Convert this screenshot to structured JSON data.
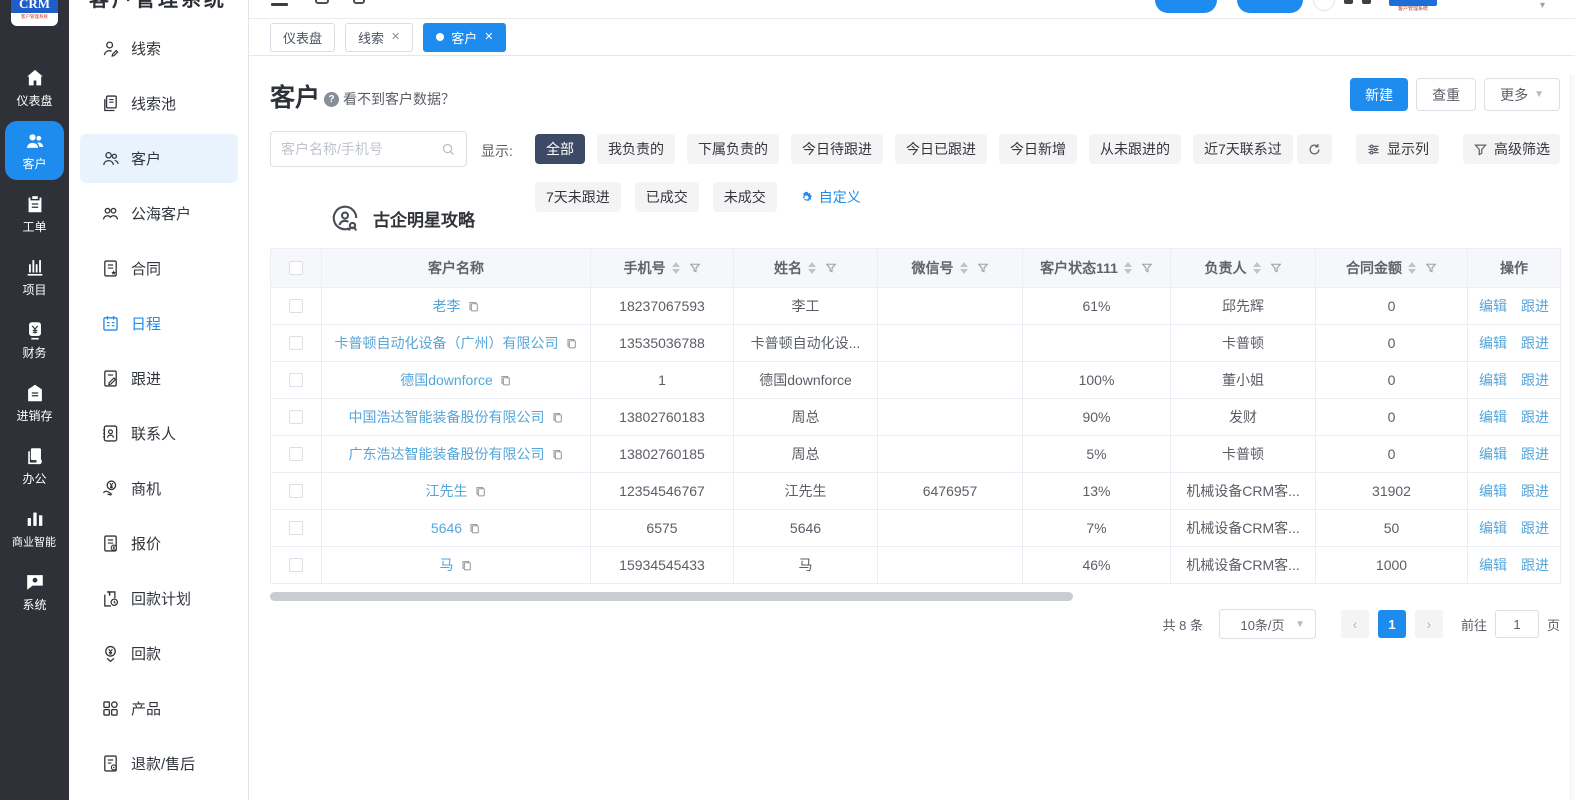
{
  "colors": {
    "accent": "#1e8cee",
    "link": "#55a6da",
    "chip_selected_bg": "#3d4a66",
    "sidebar_bg": "#2e3138"
  },
  "logo": {
    "title": "CRM",
    "subtitle": "客户管理系统"
  },
  "primary_nav": [
    {
      "label": "仪表盘",
      "icon": "dashboard-home-icon",
      "active": false
    },
    {
      "label": "客户",
      "icon": "customers-icon",
      "active": true
    },
    {
      "label": "工单",
      "icon": "work-order-icon",
      "active": false
    },
    {
      "label": "项目",
      "icon": "project-icon",
      "active": false
    },
    {
      "label": "财务",
      "icon": "finance-icon",
      "active": false
    },
    {
      "label": "进销存",
      "icon": "inventory-icon",
      "active": false
    },
    {
      "label": "办公",
      "icon": "office-icon",
      "active": false
    },
    {
      "label": "商业智能",
      "icon": "bi-icon",
      "active": false
    },
    {
      "label": "系统",
      "icon": "system-icon",
      "active": false
    }
  ],
  "secondary_nav": [
    {
      "label": "线索",
      "icon": "leads-icon",
      "active": false,
      "highlight": false
    },
    {
      "label": "线索池",
      "icon": "lead-pool-icon",
      "active": false,
      "highlight": false
    },
    {
      "label": "客户",
      "icon": "customer-icon",
      "active": true,
      "highlight": false
    },
    {
      "label": "公海客户",
      "icon": "public-customers-icon",
      "active": false,
      "highlight": false
    },
    {
      "label": "合同",
      "icon": "contract-icon",
      "active": false,
      "highlight": false
    },
    {
      "label": "日程",
      "icon": "schedule-icon",
      "active": false,
      "highlight": true
    },
    {
      "label": "跟进",
      "icon": "follow-up-icon",
      "active": false,
      "highlight": false
    },
    {
      "label": "联系人",
      "icon": "contacts-icon",
      "active": false,
      "highlight": false
    },
    {
      "label": "商机",
      "icon": "opportunity-icon",
      "active": false,
      "highlight": false
    },
    {
      "label": "报价",
      "icon": "quotation-icon",
      "active": false,
      "highlight": false
    },
    {
      "label": "回款计划",
      "icon": "payment-plan-icon",
      "active": false,
      "highlight": false
    },
    {
      "label": "回款",
      "icon": "payment-icon",
      "active": false,
      "highlight": false
    },
    {
      "label": "产品",
      "icon": "product-icon",
      "active": false,
      "highlight": false
    },
    {
      "label": "退款/售后",
      "icon": "refund-icon",
      "active": false,
      "highlight": false
    }
  ],
  "tabs": [
    {
      "label": "仪表盘",
      "closable": false,
      "active": false
    },
    {
      "label": "线索",
      "closable": true,
      "active": false
    },
    {
      "label": "客户",
      "closable": true,
      "active": true
    }
  ],
  "page": {
    "title": "客户",
    "help_hint": "看不到客户数据？"
  },
  "actions": {
    "create": "新建",
    "dedupe": "查重",
    "more": "更多"
  },
  "search": {
    "placeholder": "客户名称/手机号"
  },
  "filters": {
    "label": "显示:",
    "row1": [
      {
        "label": "全部",
        "selected": true
      },
      {
        "label": "我负责的",
        "selected": false
      },
      {
        "label": "下属负责的",
        "selected": false
      },
      {
        "label": "今日待跟进",
        "selected": false
      },
      {
        "label": "今日已跟进",
        "selected": false
      },
      {
        "label": "今日新增",
        "selected": false
      },
      {
        "label": "从未跟进的",
        "selected": false
      },
      {
        "label": "近7天联系过",
        "selected": false
      }
    ],
    "row2": [
      {
        "label": "7天未跟进",
        "selected": false
      },
      {
        "label": "已成交",
        "selected": false
      },
      {
        "label": "未成交",
        "selected": false
      }
    ],
    "custom_label": "自定义",
    "tools": {
      "columns": "显示列",
      "advanced": "高级筛选"
    }
  },
  "group": {
    "title": "古企明星攻略"
  },
  "table": {
    "columns": [
      {
        "label": "",
        "type": "checkbox"
      },
      {
        "label": "客户名称",
        "sortable": false,
        "filterable": false
      },
      {
        "label": "手机号",
        "sortable": true,
        "filterable": true
      },
      {
        "label": "姓名",
        "sortable": true,
        "filterable": true
      },
      {
        "label": "微信号",
        "sortable": true,
        "filterable": true
      },
      {
        "label": "客户状态111",
        "sortable": true,
        "filterable": true
      },
      {
        "label": "负责人",
        "sortable": true,
        "filterable": true
      },
      {
        "label": "合同金额",
        "sortable": true,
        "filterable": true
      },
      {
        "label": "操作",
        "sortable": false,
        "filterable": false
      }
    ],
    "rows": [
      {
        "name": "老李",
        "phone": "18237067593",
        "person": "李工",
        "wechat": "",
        "status": "61%",
        "owner": "邱先辉",
        "amount": "0"
      },
      {
        "name": "卡普顿自动化设备（广州）有限公司",
        "phone": "13535036788",
        "person": "卡普顿自动化设...",
        "wechat": "",
        "status": "",
        "owner": "卡普顿",
        "amount": "0"
      },
      {
        "name": "德国downforce",
        "phone": "1",
        "person": "德国downforce",
        "wechat": "",
        "status": "100%",
        "owner": "董小姐",
        "amount": "0"
      },
      {
        "name": "中国浩达智能装备股份有限公司",
        "phone": "13802760183",
        "person": "周总",
        "wechat": "",
        "status": "90%",
        "owner": "发财",
        "amount": "0"
      },
      {
        "name": "广东浩达智能装备股份有限公司",
        "phone": "13802760185",
        "person": "周总",
        "wechat": "",
        "status": "5%",
        "owner": "卡普顿",
        "amount": "0"
      },
      {
        "name": "江先生",
        "phone": "12354546767",
        "person": "江先生",
        "wechat": "6476957",
        "status": "13%",
        "owner": "机械设备CRM客...",
        "amount": "31902"
      },
      {
        "name": "5646",
        "phone": "6575",
        "person": "5646",
        "wechat": "",
        "status": "7%",
        "owner": "机械设备CRM客...",
        "amount": "50"
      },
      {
        "name": "马",
        "phone": "15934545433",
        "person": "马",
        "wechat": "",
        "status": "46%",
        "owner": "机械设备CRM客...",
        "amount": "1000"
      }
    ],
    "ops": [
      "编辑",
      "跟进"
    ]
  },
  "pagination": {
    "total": "共 8 条",
    "page_size": "10条/页",
    "current": "1",
    "goto_label": "前往",
    "goto_value": "1",
    "page_label": "页"
  }
}
